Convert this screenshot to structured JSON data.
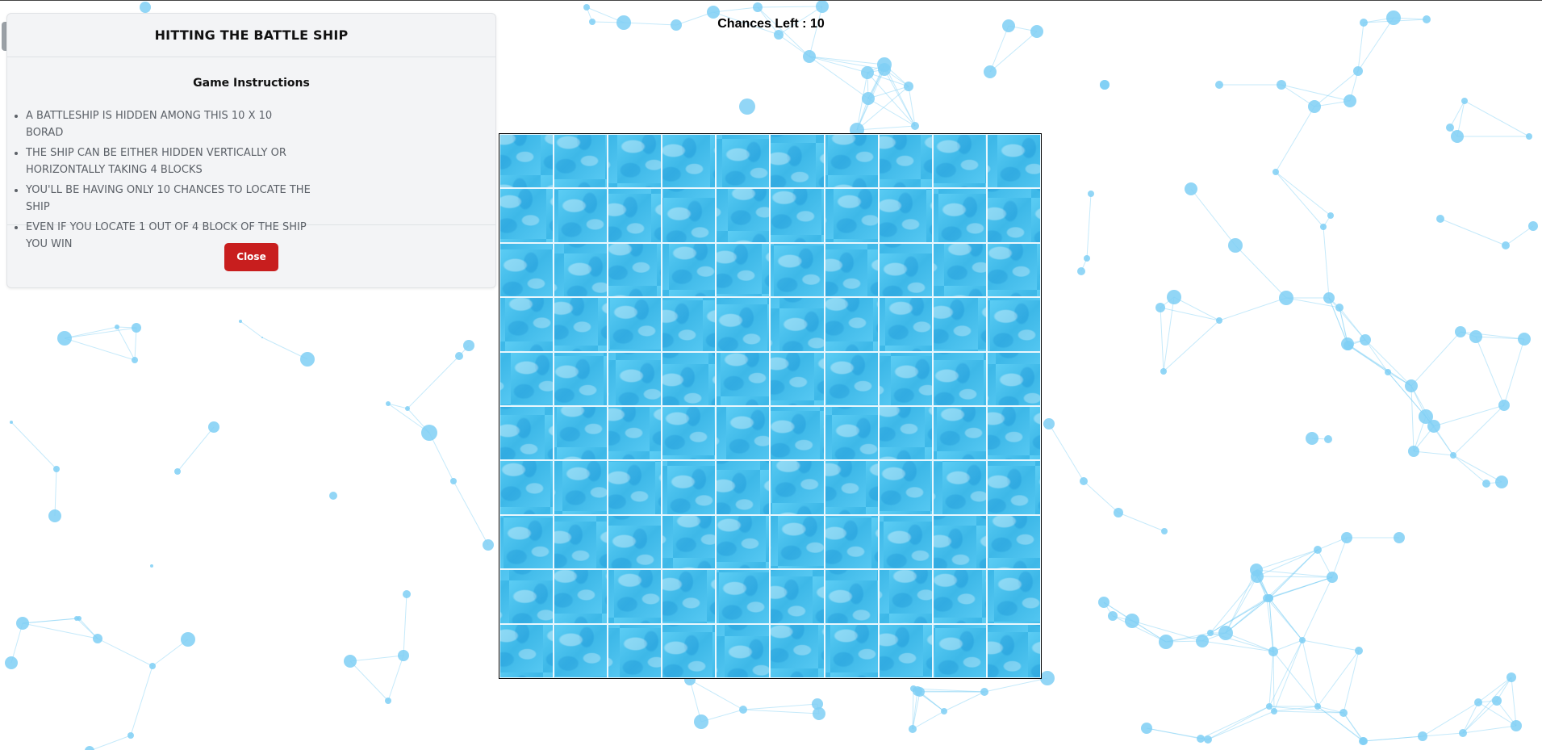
{
  "status": {
    "chances_left": "Chances Left : 10"
  },
  "modal": {
    "title": "HITTING THE BATTLE SHIP",
    "heading": "Game Instructions",
    "instructions": [
      "A BATTLESHIP IS HIDDEN AMONG THIS 10 X 10 BORAD",
      "THE SHIP CAN BE EITHER HIDDEN VERTICALLY OR HORIZONTALLY TAKING 4 BLOCKS",
      "YOU'LL BE HAVING ONLY 10 CHANCES TO LOCATE THE SHIP",
      "EVEN IF YOU LOCATE 1 OUT OF 4 BLOCK OF THE SHIP YOU WIN"
    ],
    "close_label": "Close"
  },
  "board": {
    "rows": 10,
    "cols": 10
  },
  "colors": {
    "water": "#4cc3ee",
    "particle": "#7fcff5",
    "close_button": "#c81e1e"
  }
}
